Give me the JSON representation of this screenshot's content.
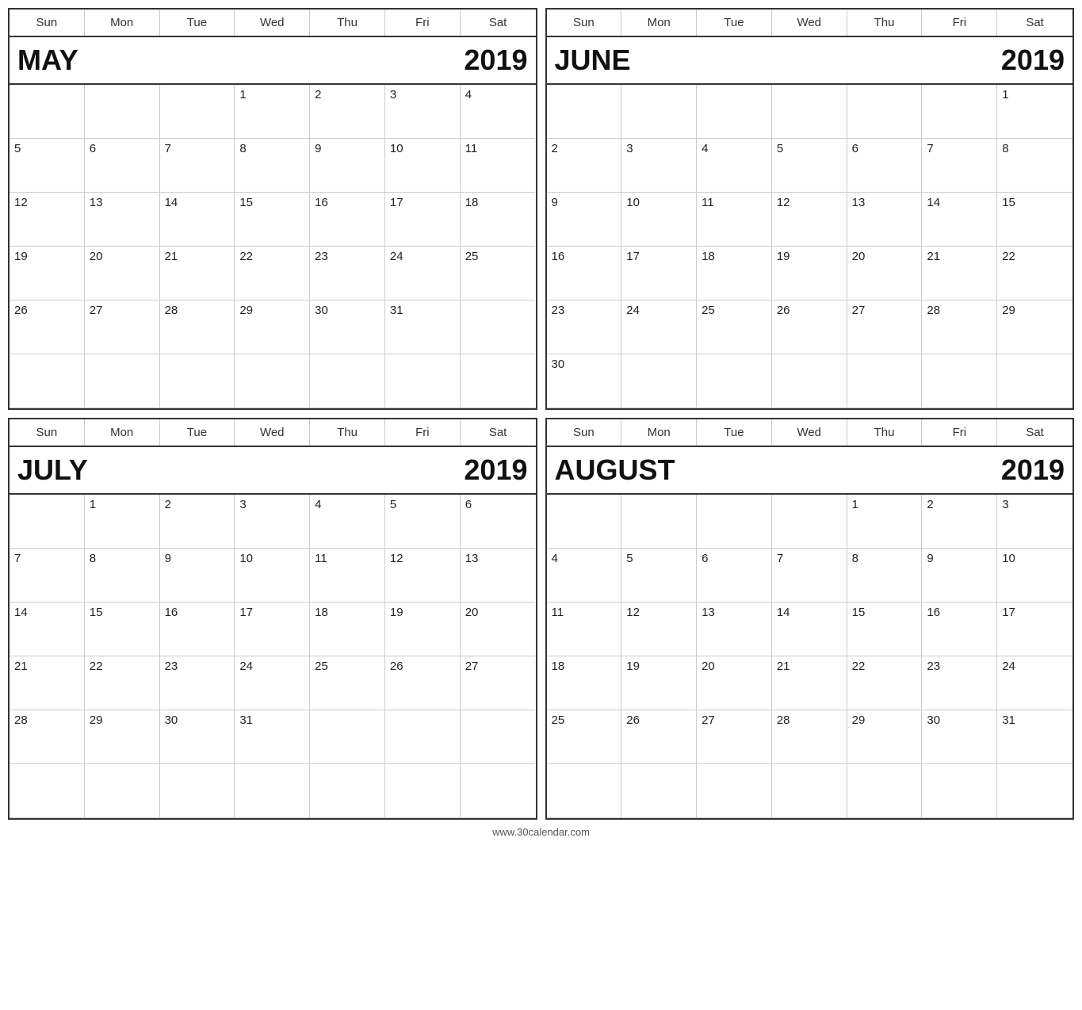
{
  "footer": "www.30calendar.com",
  "dayHeaders": [
    "Sun",
    "Mon",
    "Tue",
    "Wed",
    "Thu",
    "Fri",
    "Sat"
  ],
  "calendars": [
    {
      "id": "may-2019",
      "monthName": "MAY",
      "year": "2019",
      "leadingEmpties": 3,
      "totalDays": 31,
      "rows": 6
    },
    {
      "id": "june-2019",
      "monthName": "JUNE",
      "year": "2019",
      "leadingEmpties": 6,
      "totalDays": 30,
      "rows": 6
    },
    {
      "id": "july-2019",
      "monthName": "JULY",
      "year": "2019",
      "leadingEmpties": 1,
      "totalDays": 31,
      "rows": 6
    },
    {
      "id": "august-2019",
      "monthName": "AUGUST",
      "year": "2019",
      "leadingEmpties": 4,
      "totalDays": 31,
      "rows": 6
    }
  ]
}
